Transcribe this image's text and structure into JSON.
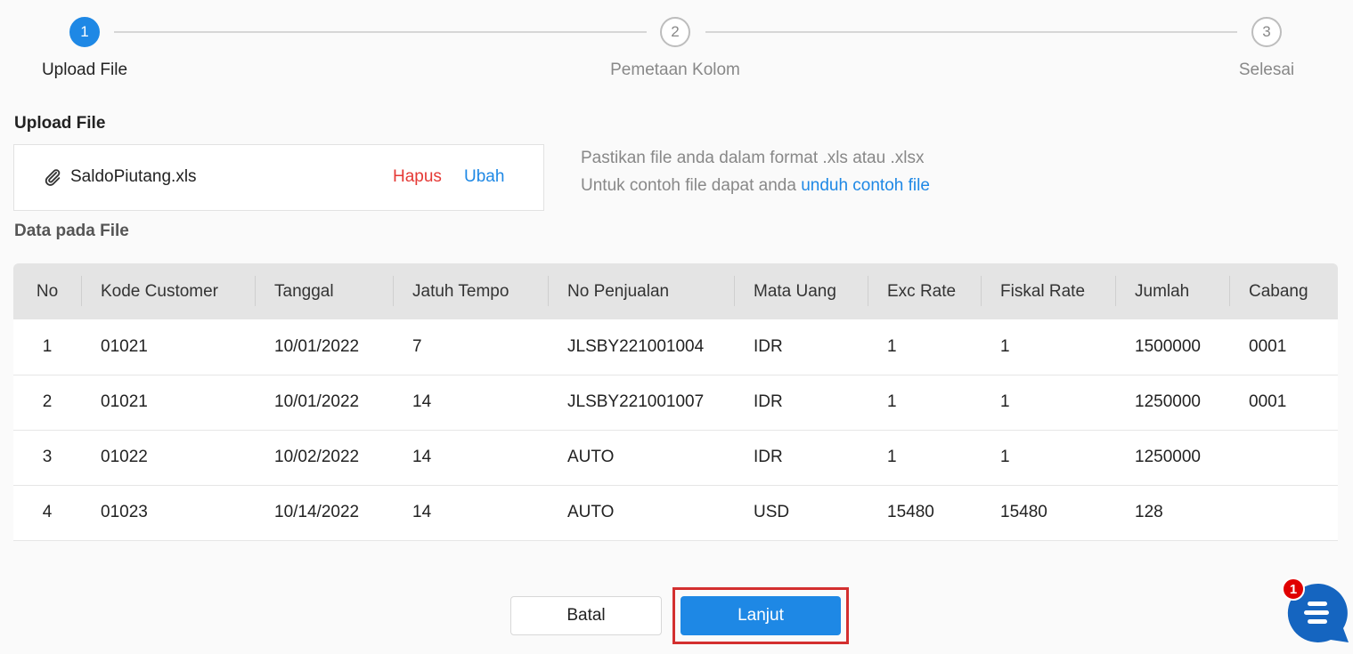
{
  "stepper": {
    "steps": [
      {
        "number": "1",
        "label": "Upload File",
        "state": "active"
      },
      {
        "number": "2",
        "label": "Pemetaan Kolom",
        "state": "inactive"
      },
      {
        "number": "3",
        "label": "Selesai",
        "state": "inactive"
      }
    ]
  },
  "upload": {
    "title": "Upload File",
    "file_name": "SaldoPiutang.xls",
    "delete_label": "Hapus",
    "change_label": "Ubah",
    "hint_line1": "Pastikan file anda dalam format .xls atau .xlsx",
    "hint_line2_prefix": "Untuk contoh file dapat anda ",
    "hint_line2_link": "unduh contoh file"
  },
  "data_section": {
    "title": "Data pada File"
  },
  "table": {
    "columns": [
      "No",
      "Kode Customer",
      "Tanggal",
      "Jatuh Tempo",
      "No Penjualan",
      "Mata Uang",
      "Exc Rate",
      "Fiskal Rate",
      "Jumlah",
      "Cabang"
    ],
    "rows": [
      [
        "1",
        "01021",
        "10/01/2022",
        "7",
        "JLSBY221001004",
        "IDR",
        "1",
        "1",
        "1500000",
        "0001"
      ],
      [
        "2",
        "01021",
        "10/01/2022",
        "14",
        "JLSBY221001007",
        "IDR",
        "1",
        "1",
        "1250000",
        "0001"
      ],
      [
        "3",
        "01022",
        "10/02/2022",
        "14",
        "AUTO",
        "IDR",
        "1",
        "1",
        "1250000",
        ""
      ],
      [
        "4",
        "01023",
        "10/14/2022",
        "14",
        "AUTO",
        "USD",
        "15480",
        "15480",
        "128",
        ""
      ]
    ]
  },
  "actions": {
    "cancel_label": "Batal",
    "next_label": "Lanjut"
  },
  "chat": {
    "badge_count": "1",
    "icon": "chat-icon"
  },
  "colors": {
    "primary": "#1e88e5",
    "danger": "#e53935",
    "highlight": "#d32f2f",
    "badge": "#e00000"
  }
}
